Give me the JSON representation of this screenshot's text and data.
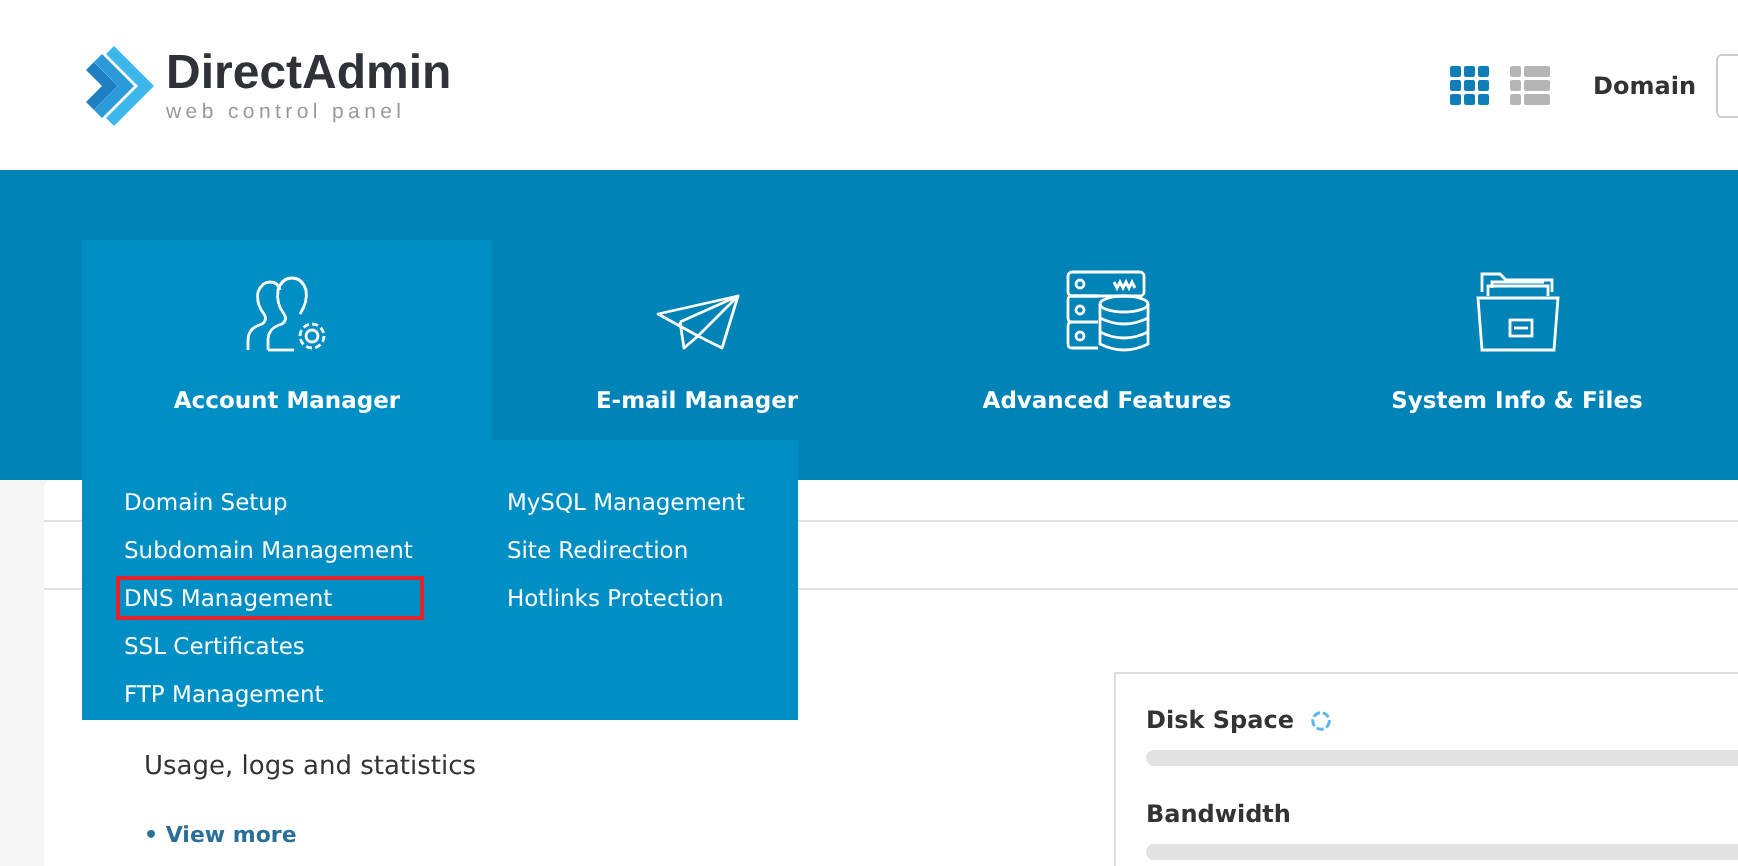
{
  "logo": {
    "name": "DirectAdmin",
    "tagline": "web control panel"
  },
  "view_toggle": [
    {
      "kind": "grid",
      "selected": true
    },
    {
      "kind": "list",
      "selected": false
    }
  ],
  "domain_label": "Domain",
  "nav": [
    {
      "kind": "users",
      "label": "Account Manager",
      "selected": true
    },
    {
      "kind": "plane",
      "label": "E-mail Manager",
      "selected": false
    },
    {
      "kind": "database",
      "label": "Advanced Features",
      "selected": false
    },
    {
      "kind": "folder",
      "label": "System Info & Files",
      "selected": false
    }
  ],
  "dropdown": {
    "columns": [
      [
        {
          "label": "Domain Setup",
          "highlighted": false
        },
        {
          "label": "Subdomain Management",
          "highlighted": false
        },
        {
          "label": "DNS Management",
          "highlighted": true
        },
        {
          "label": "SSL Certificates",
          "highlighted": false
        },
        {
          "label": "FTP Management",
          "highlighted": false
        }
      ],
      [
        {
          "label": "MySQL Management",
          "highlighted": false
        },
        {
          "label": "Site Redirection",
          "highlighted": false
        },
        {
          "label": "Hotlinks Protection",
          "highlighted": false
        }
      ]
    ]
  },
  "section": {
    "description": "Usage, logs and statistics",
    "link": "• View more"
  },
  "usage": [
    {
      "label": "Disk Space",
      "loading": true,
      "level": 0
    },
    {
      "label": "Bandwidth",
      "loading": false,
      "level": 0
    }
  ]
}
